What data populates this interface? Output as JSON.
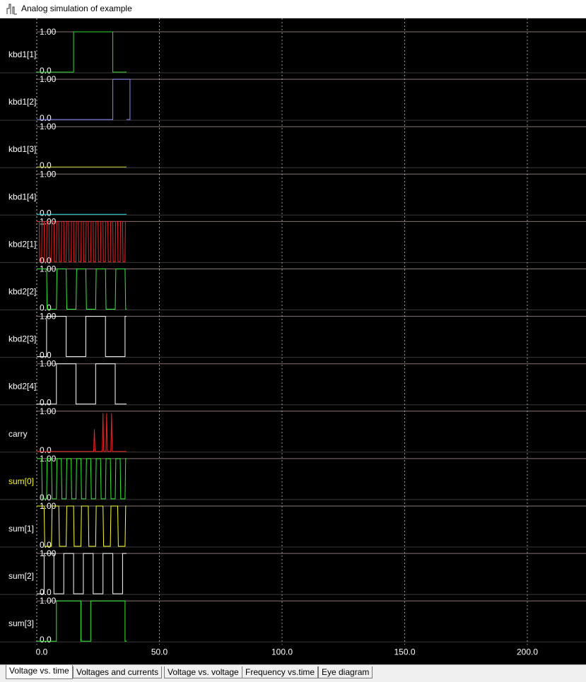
{
  "window": {
    "title": "Analog simulation of example",
    "icon": "waveform-app-icon"
  },
  "colors": {
    "background": "#000000",
    "grid_vertical": "#d8d8d8",
    "grid_horizontal": "#8a7474",
    "label_default": "#ffffff",
    "label_highlight": "#ffff00",
    "axis_text": "#ffffff"
  },
  "x_axis": {
    "ticks": [
      "0.0",
      "50.0",
      "100.0",
      "150.0",
      "200.0"
    ],
    "tick_values": [
      0,
      50,
      100,
      150,
      200
    ],
    "range": [
      0,
      225
    ]
  },
  "traces": [
    {
      "name": "kbd1[1]",
      "color": "#33dd33",
      "label_color": "#ffffff",
      "ymax": "1.00",
      "ymin": "0.0",
      "kind": "pulses",
      "edges": [
        15,
        31
      ]
    },
    {
      "name": "kbd1[2]",
      "color": "#8888ff",
      "label_color": "#ffffff",
      "ymax": "1.00",
      "ymin": "0.0",
      "kind": "pulses",
      "edges": [
        31,
        38
      ]
    },
    {
      "name": "kbd1[3]",
      "color": "#cccc33",
      "label_color": "#ffffff",
      "ymax": "1.00",
      "ymin": "0.0",
      "kind": "pulses",
      "edges": []
    },
    {
      "name": "kbd1[4]",
      "color": "#33dddd",
      "label_color": "#ffffff",
      "ymax": "1.00",
      "ymin": "0.0",
      "kind": "pulses",
      "edges": []
    },
    {
      "name": "kbd2[1]",
      "color": "#ee2222",
      "label_color": "#ffffff",
      "ymax": "1.00",
      "ymin": "0.0",
      "kind": "square",
      "start_high": true,
      "period": 1.0,
      "trap": true
    },
    {
      "name": "kbd2[2]",
      "color": "#33ee33",
      "label_color": "#ffffff",
      "ymax": "1.00",
      "ymin": "0.0",
      "kind": "square",
      "start_high": true,
      "period": 4.0,
      "trap": true
    },
    {
      "name": "kbd2[3]",
      "color": "#ffffff",
      "label_color": "#ffffff",
      "ymax": "1.00",
      "ymin": "0.0",
      "kind": "square",
      "start_high": false,
      "period": 8.0,
      "phase": 4.0,
      "trap": false
    },
    {
      "name": "kbd2[4]",
      "color": "#ffffff",
      "label_color": "#ffffff",
      "ymax": "1.00",
      "ymin": "0.0",
      "kind": "pulses",
      "edges": [
        8,
        16,
        24,
        32
      ]
    },
    {
      "name": "carry",
      "color": "#ee2222",
      "label_color": "#ffffff",
      "ymax": "1.00",
      "ymin": "0.0",
      "kind": "spikes",
      "spikes": [
        [
          23.5,
          0.55
        ],
        [
          27.0,
          0.95
        ],
        [
          28.5,
          0.95
        ],
        [
          30.5,
          0.95
        ]
      ]
    },
    {
      "name": "sum[0]",
      "color": "#33ee33",
      "label_color": "#ffff00",
      "ymax": "1.00",
      "ymin": "0.0",
      "kind": "square",
      "start_high": true,
      "period": 2.0,
      "trap": true
    },
    {
      "name": "sum[1]",
      "color": "#ffff33",
      "label_color": "#ffffff",
      "ymax": "1.00",
      "ymin": "0.0",
      "kind": "square",
      "start_high": true,
      "period": 3.0,
      "trap": true
    },
    {
      "name": "sum[2]",
      "color": "#ffffff",
      "label_color": "#ffffff",
      "ymax": "1.00",
      "ymin": "0.0",
      "kind": "square",
      "start_high": false,
      "period": 4.0,
      "phase": 3.0,
      "trap": false
    },
    {
      "name": "sum[3]",
      "color": "#33ee33",
      "label_color": "#ffffff",
      "ymax": "1.00",
      "ymin": "0.0",
      "kind": "pulses",
      "edges": [
        8,
        18,
        22,
        36
      ]
    }
  ],
  "tabs": [
    {
      "label": "Voltage vs. time",
      "active": true
    },
    {
      "label": "Voltages and currents",
      "active": false
    },
    {
      "label": "Voltage vs. voltage",
      "active": false
    },
    {
      "label": "Frequency vs.time",
      "active": false
    },
    {
      "label": "Eye diagram",
      "active": false
    }
  ]
}
